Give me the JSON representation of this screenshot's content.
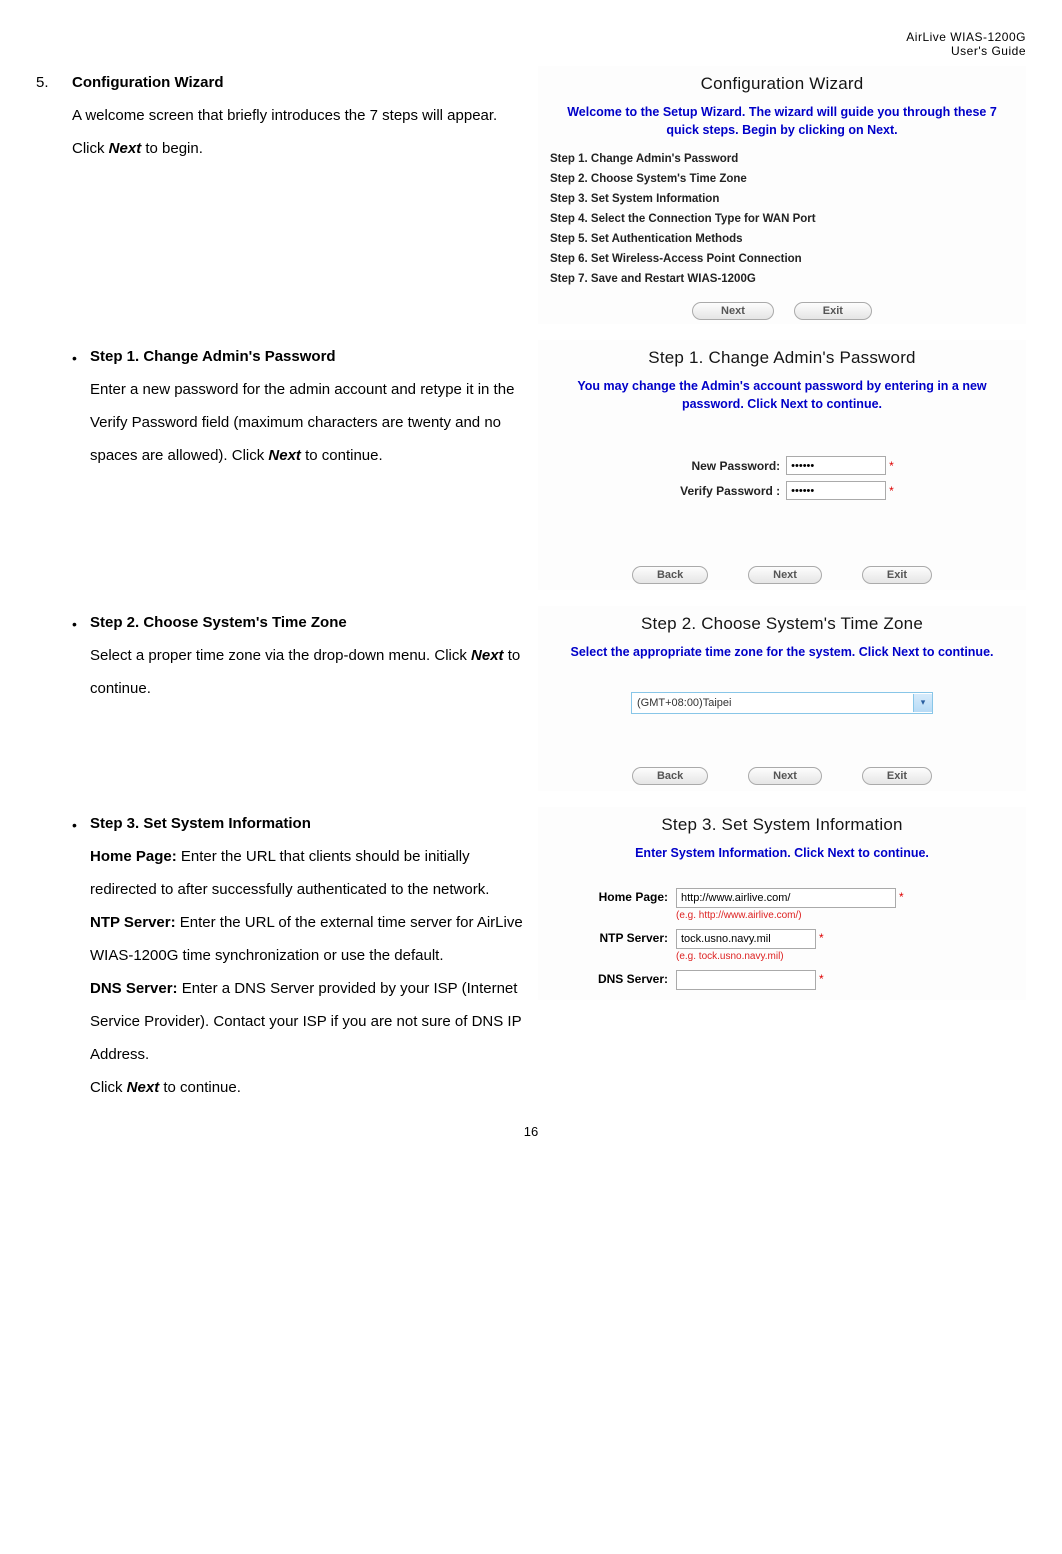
{
  "header": {
    "line1": "AirLive WIAS-1200G",
    "line2": "User's Guide"
  },
  "section5": {
    "num": "5.",
    "title": "Configuration Wizard",
    "body_a": "A welcome screen that briefly introduces the 7 steps will appear. Click ",
    "body_b": "Next",
    "body_c": " to begin."
  },
  "wizard_panel": {
    "title": "Configuration Wizard",
    "subtitle": "Welcome to the Setup Wizard. The wizard will guide you through these 7 quick steps. Begin by clicking on Next.",
    "steps": [
      "Step 1. Change Admin's Password",
      "Step 2. Choose System's Time Zone",
      "Step 3. Set System Information",
      "Step 4. Select the Connection Type for WAN Port",
      "Step 5. Set Authentication Methods",
      "Step 6. Set Wireless-Access Point Connection",
      "Step 7. Save and Restart WIAS-1200G"
    ],
    "btn_next": "Next",
    "btn_exit": "Exit"
  },
  "step1_left": {
    "bullet": "Step 1. Change Admin's Password",
    "body_a": "Enter a new password for the admin account and retype it in the Verify Password field (maximum characters are twenty and no spaces are allowed). Click ",
    "body_b": "Next",
    "body_c": " to continue."
  },
  "step1_panel": {
    "title": "Step 1. Change Admin's Password",
    "subtitle": "You may change the Admin's account password by entering in a new password. Click Next to continue.",
    "new_pw_label": "New Password:",
    "verify_pw_label": "Verify Password :",
    "btn_back": "Back",
    "btn_next": "Next",
    "btn_exit": "Exit"
  },
  "step2_left": {
    "bullet": "Step 2. Choose System's Time Zone",
    "body_a": "Select a proper time zone via the drop-down menu. Click ",
    "body_b": "Next",
    "body_c": " to continue."
  },
  "step2_panel": {
    "title": "Step 2. Choose System's Time Zone",
    "subtitle": "Select the appropriate time zone for the system. Click Next to continue.",
    "tz_value": "(GMT+08:00)Taipei",
    "btn_back": "Back",
    "btn_next": "Next",
    "btn_exit": "Exit"
  },
  "step3_left": {
    "bullet": "Step 3. Set System Information",
    "hp_label": "Home Page: ",
    "hp_text": "Enter the URL that clients should be initially redirected to after successfully authenticated to the network.",
    "ntp_label": "NTP Server: ",
    "ntp_text": "Enter the URL of the external time server for AirLive WIAS-1200G time synchronization or use the default.",
    "dns_label": "DNS Server: ",
    "dns_text": "Enter a DNS Server provided by your ISP (Internet Service Provider). Contact your ISP if you are not sure of DNS IP Address.",
    "cont_a": "Click ",
    "cont_b": "Next",
    "cont_c": " to continue."
  },
  "step3_panel": {
    "title": "Step 3. Set System Information",
    "subtitle": "Enter System Information. Click Next to continue.",
    "home_label": "Home Page:",
    "home_value": "http://www.airlive.com/",
    "home_hint": "(e.g. http://www.airlive.com/)",
    "ntp_label": "NTP Server:",
    "ntp_value": "tock.usno.navy.mil",
    "ntp_hint": "(e.g. tock.usno.navy.mil)",
    "dns_label": "DNS Server:",
    "dns_value": ""
  },
  "page_number": "16"
}
